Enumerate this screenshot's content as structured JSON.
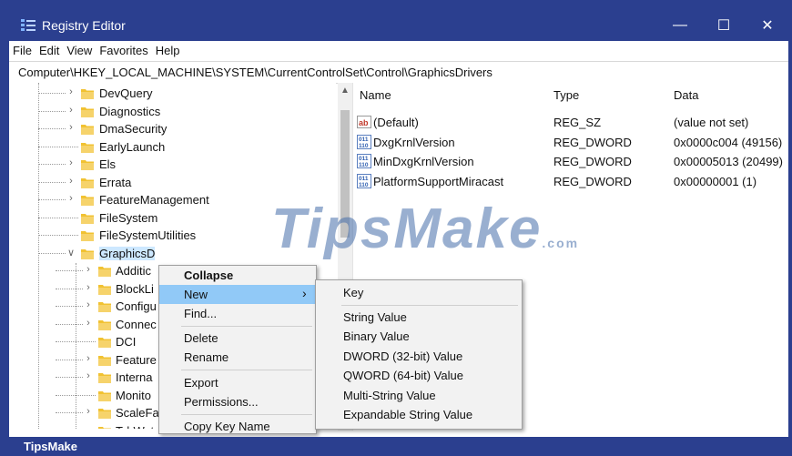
{
  "window": {
    "title": "Registry Editor",
    "minimize_glyph": "—",
    "maximize_glyph": "☐",
    "close_glyph": "✕"
  },
  "menu": [
    "File",
    "Edit",
    "View",
    "Favorites",
    "Help"
  ],
  "address": "Computer\\HKEY_LOCAL_MACHINE\\SYSTEM\\CurrentControlSet\\Control\\GraphicsDrivers",
  "tree": {
    "parent_items": [
      {
        "label": "DevQuery",
        "expandable": true
      },
      {
        "label": "Diagnostics",
        "expandable": true
      },
      {
        "label": "DmaSecurity",
        "expandable": true
      },
      {
        "label": "EarlyLaunch",
        "expandable": false
      },
      {
        "label": "Els",
        "expandable": true
      },
      {
        "label": "Errata",
        "expandable": true
      },
      {
        "label": "FeatureManagement",
        "expandable": true
      },
      {
        "label": "FileSystem",
        "expandable": false
      },
      {
        "label": "FileSystemUtilities",
        "expandable": false
      },
      {
        "label": "GraphicsD",
        "expandable": true,
        "expanded": true,
        "selected": true
      }
    ],
    "child_items": [
      {
        "label": "Additic",
        "expandable": true
      },
      {
        "label": "BlockLi",
        "expandable": true
      },
      {
        "label": "Configu",
        "expandable": true
      },
      {
        "label": "Connec",
        "expandable": true
      },
      {
        "label": "DCI",
        "expandable": false
      },
      {
        "label": "Feature",
        "expandable": true
      },
      {
        "label": "Interna",
        "expandable": true
      },
      {
        "label": "Monito",
        "expandable": false
      },
      {
        "label": "ScaleFa",
        "expandable": true
      },
      {
        "label": "TdrWatch",
        "expandable": false
      }
    ]
  },
  "list": {
    "headers": {
      "name": "Name",
      "type": "Type",
      "data": "Data"
    },
    "rows": [
      {
        "icon": "string-value-icon",
        "name": "(Default)",
        "type": "REG_SZ",
        "data": "(value not set)"
      },
      {
        "icon": "binary-value-icon",
        "name": "DxgKrnlVersion",
        "type": "REG_DWORD",
        "data": "0x0000c004 (49156)"
      },
      {
        "icon": "binary-value-icon",
        "name": "MinDxgKrnlVersion",
        "type": "REG_DWORD",
        "data": "0x00005013 (20499)"
      },
      {
        "icon": "binary-value-icon",
        "name": "PlatformSupportMiracast",
        "type": "REG_DWORD",
        "data": "0x00000001 (1)"
      }
    ]
  },
  "context_menu": {
    "collapse": "Collapse",
    "new": "New",
    "new_arrow": "›",
    "find": "Find...",
    "delete": "Delete",
    "rename": "Rename",
    "export": "Export",
    "permissions": "Permissions...",
    "copy_key_name": "Copy Key Name"
  },
  "submenu": {
    "key": "Key",
    "string_value": "String Value",
    "binary_value": "Binary Value",
    "dword_value": "DWORD (32-bit) Value",
    "qword_value": "QWORD (64-bit) Value",
    "multi_string_value": "Multi-String Value",
    "expandable_string_value": "Expandable String Value"
  },
  "watermark": {
    "text": "TipsMake",
    "suffix": ".com"
  },
  "footer": {
    "brand": "TipsMake"
  },
  "colors": {
    "titlebar": "#2b3f8f",
    "selection": "#cde8ff",
    "menu_highlight": "#91c9f7",
    "folder": "#f1c232"
  }
}
